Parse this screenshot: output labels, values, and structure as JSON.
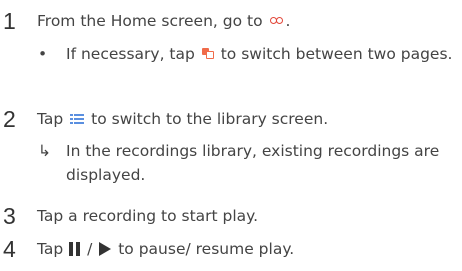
{
  "steps": [
    {
      "number": "1",
      "before": "From the Home screen, go to",
      "icon": "voice-recorder-icon",
      "after": ".",
      "sub": {
        "marker": "•",
        "before": "If necessary, tap",
        "icon": "switch-pages-icon",
        "after": "to switch between two pages."
      }
    },
    {
      "number": "2",
      "before": "Tap",
      "icon": "library-list-icon",
      "after": "to switch to the library screen.",
      "sub": {
        "marker": "↳",
        "text": "In the recordings library, existing recordings are displayed."
      }
    },
    {
      "number": "3",
      "text": "Tap a recording to start play."
    },
    {
      "number": "4",
      "before": "Tap",
      "icons": [
        "pause-icon",
        "play-icon"
      ],
      "separator": "/",
      "after": "to pause/ resume play."
    }
  ],
  "colors": {
    "text": "#444444",
    "number": "#333333",
    "voice_icon": "#e2473a",
    "switch_icon": "#f06b4a",
    "list_icon": "#5a8fe0"
  }
}
